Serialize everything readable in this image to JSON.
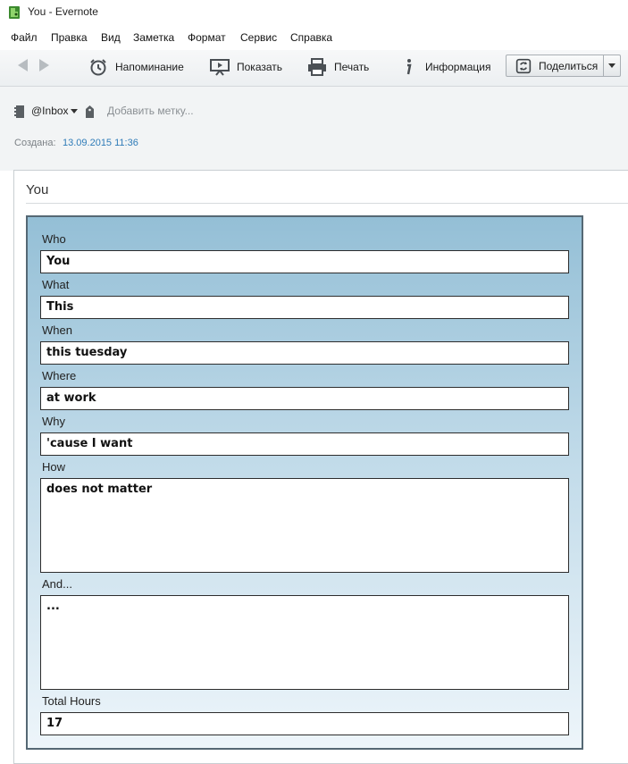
{
  "window": {
    "title": "You - Evernote"
  },
  "menu": [
    "Файл",
    "Правка",
    "Вид",
    "Заметка",
    "Формат",
    "Сервис",
    "Справка"
  ],
  "toolbar": {
    "reminder": "Напоминание",
    "present": "Показать",
    "print": "Печать",
    "info": "Информация",
    "share": "Поделиться"
  },
  "meta": {
    "notebook": "@Inbox",
    "tag_placeholder": "Добавить метку...",
    "created_label": "Создана:",
    "created_value": "13.09.2015 11:36"
  },
  "note": {
    "title": "You",
    "fields": [
      {
        "label": "Who",
        "value": "You"
      },
      {
        "label": "What",
        "value": "This"
      },
      {
        "label": "When",
        "value": "this tuesday"
      },
      {
        "label": "Where",
        "value": "at work"
      },
      {
        "label": "Why",
        "value": "'cause I want"
      },
      {
        "label": "How",
        "value": "does not matter"
      },
      {
        "label": "And...",
        "value": "..."
      },
      {
        "label": "Total Hours",
        "value": "17"
      }
    ]
  },
  "colors": {
    "panel_top": "#94bfd6",
    "panel_bottom": "#edf5fa",
    "panel_border": "#556874",
    "link_blue": "#2e7bb8"
  },
  "icons": [
    "evernote-logo-icon",
    "back-arrow-icon",
    "forward-arrow-icon",
    "alarm-clock-icon",
    "presentation-icon",
    "printer-icon",
    "info-icon",
    "share-sync-icon",
    "chevron-down-icon",
    "notebook-icon",
    "tag-icon"
  ]
}
